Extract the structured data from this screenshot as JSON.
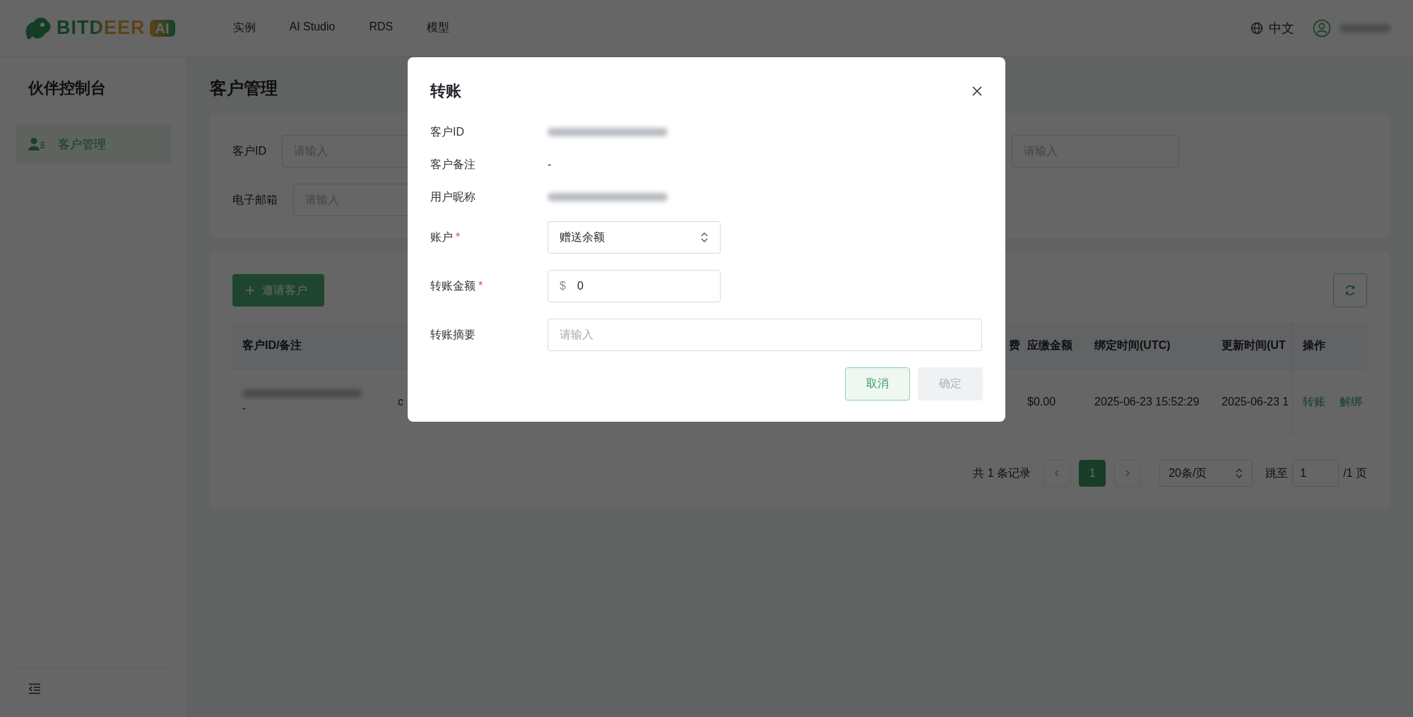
{
  "header": {
    "logo": {
      "name": "BITDEER",
      "badge": "AI"
    },
    "nav": [
      {
        "label": "实例"
      },
      {
        "label": "AI Studio"
      },
      {
        "label": "RDS"
      },
      {
        "label": "模型"
      }
    ],
    "language": "中文",
    "user": {
      "redacted": true
    }
  },
  "sidebar": {
    "title": "伙伴控制台",
    "items": [
      {
        "label": "客户管理",
        "selected": true
      }
    ]
  },
  "page": {
    "title": "客户管理",
    "filters": [
      {
        "label": "客户ID",
        "placeholder": "请输入"
      },
      {
        "placeholder": "请输入"
      },
      {
        "label": "电子邮箱",
        "placeholder": "请输入"
      }
    ],
    "invite_button": "邀请客户"
  },
  "table": {
    "columns": [
      {
        "label": "客户ID/备注"
      },
      {
        "label": "费"
      },
      {
        "label": "应缴金额"
      },
      {
        "label": "绑定时间(UTC)"
      },
      {
        "label": "更新时间(UT"
      },
      {
        "label": "操作"
      }
    ],
    "rows": [
      {
        "id_redacted": true,
        "remark": "-",
        "column_2": "c",
        "amount": "$0.00",
        "bound_time": "2025-06-23 15:52:29",
        "updated_time": "2025-06-23 1",
        "actions": [
          {
            "label": "转账"
          },
          {
            "label": "解绑"
          }
        ]
      }
    ]
  },
  "pagination": {
    "total": "共 1 条记录",
    "pages": [
      {
        "label": "1",
        "selected": true
      }
    ],
    "page_size": "20条/页",
    "jump_label": "跳至",
    "jump_value": "1",
    "page_count": "/1 页"
  },
  "dialog": {
    "title": "转账",
    "info": [
      {
        "label": "客户ID",
        "redacted": true
      },
      {
        "label": "客户备注",
        "redacted": false,
        "value": "-"
      },
      {
        "label": "用户昵称",
        "redacted": true
      }
    ],
    "fields": [
      {
        "kind": "select",
        "label": "账户",
        "required_mark": "*",
        "value": "赠送余额"
      },
      {
        "kind": "money",
        "label": "转账金额",
        "required_mark": "*",
        "prefix": "$",
        "value": "0"
      },
      {
        "kind": "text",
        "label": "转账摘要",
        "placeholder": "请输入"
      }
    ],
    "buttons": [
      {
        "label": "取消",
        "kind": "secondary",
        "disabled": false
      },
      {
        "label": "确定",
        "kind": "primary",
        "disabled": true
      }
    ]
  }
}
